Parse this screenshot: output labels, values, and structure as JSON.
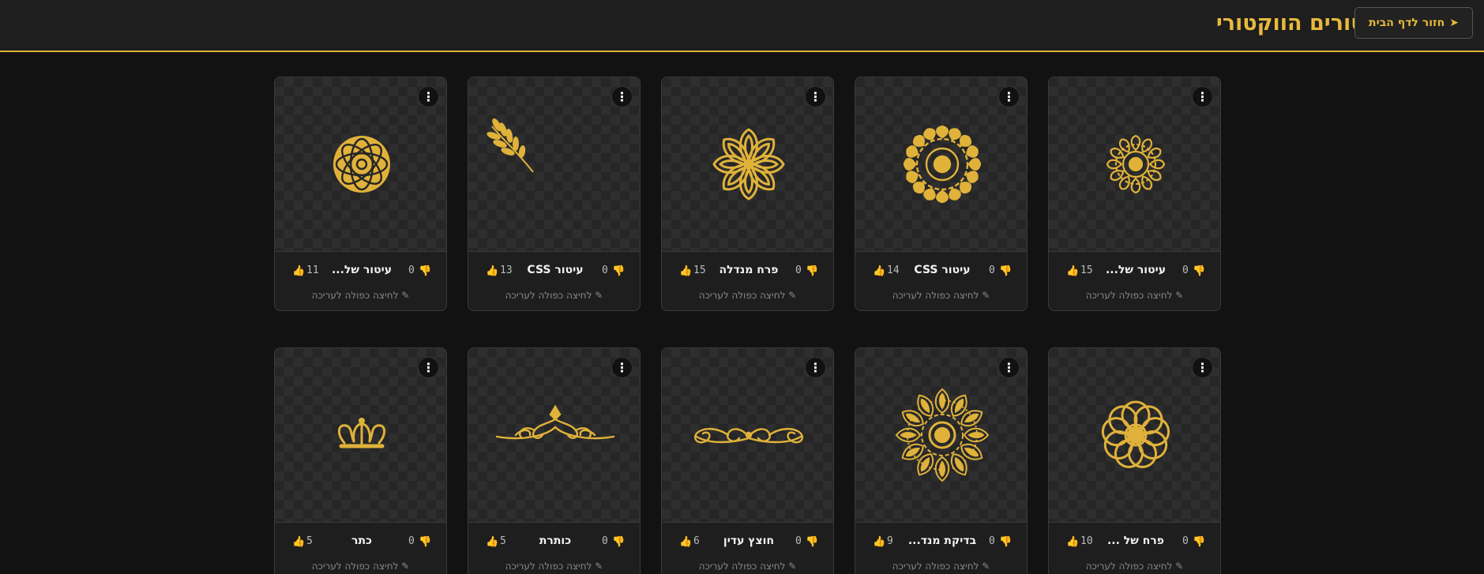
{
  "header": {
    "title": "מאגר העיטורים הווקטורי",
    "back_label": "חזור לדף הבית",
    "back_icon": "➤"
  },
  "colors": {
    "accent": "#e8b93c",
    "background": "#121212",
    "card": "#1e1e1e"
  },
  "card_common": {
    "menu_icon": "⋮",
    "edit_hint": "✎ לחיצה כפולה לעריכה",
    "like_icon": "👍",
    "dislike_icon": "👎"
  },
  "cards": [
    {
      "name": "עיטור של...",
      "likes": "15",
      "dislikes": "0",
      "icon": "small-mandala-icon"
    },
    {
      "name": "עיטור CSS",
      "likes": "14",
      "dislikes": "0",
      "icon": "ring-mandala-icon"
    },
    {
      "name": "פרח מנדלה",
      "likes": "15",
      "dislikes": "0",
      "icon": "flower-mandala-icon"
    },
    {
      "name": "עיטור CSS",
      "likes": "13",
      "dislikes": "0",
      "icon": "branch-icon"
    },
    {
      "name": "עיטור של...",
      "likes": "11",
      "dislikes": "0",
      "icon": "knot-sphere-icon"
    },
    {
      "name": "פרח של ...",
      "likes": "10",
      "dislikes": "0",
      "icon": "swirl-flower-icon"
    },
    {
      "name": "בדיקת מנד...",
      "likes": "9",
      "dislikes": "0",
      "icon": "large-mandala-icon"
    },
    {
      "name": "חוצץ עדין",
      "likes": "6",
      "dislikes": "0",
      "icon": "scroll-divider-icon"
    },
    {
      "name": "כותרת",
      "likes": "5",
      "dislikes": "0",
      "icon": "header-flourish-icon"
    },
    {
      "name": "כתר",
      "likes": "5",
      "dislikes": "0",
      "icon": "crown-icon"
    }
  ]
}
